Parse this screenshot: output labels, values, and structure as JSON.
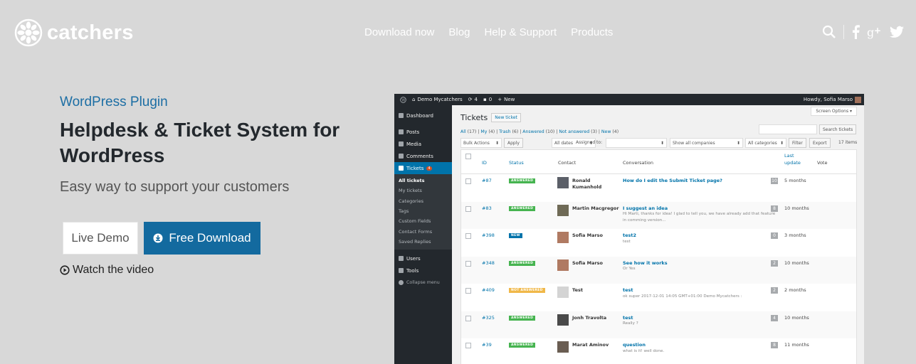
{
  "brand": {
    "name": "catchers"
  },
  "nav": [
    "Download now",
    "Blog",
    "Help & Support",
    "Products"
  ],
  "social_icons": [
    "search-icon",
    "facebook-icon",
    "google-plus-icon",
    "twitter-icon"
  ],
  "hero": {
    "eyebrow": "WordPress Plugin",
    "title": "Helpdesk & Ticket System for WordPress",
    "subtitle": "Easy way to support your customers",
    "live_demo": "Live Demo",
    "free_download": "Free Download",
    "watch_video": "Watch the video"
  },
  "colors": {
    "background": "#d8d8d8",
    "accent": "#1c6ea4",
    "download_button": "#136a9f",
    "wp_dark": "#23282d",
    "wp_blue": "#0073aa"
  },
  "screenshot": {
    "admin_bar": {
      "site": "Demo Mycatchers",
      "updates": "4",
      "comments": "0",
      "new": "New",
      "howdy": "Howdy, Sofia Marso"
    },
    "menu": {
      "dashboard": "Dashboard",
      "posts": "Posts",
      "media": "Media",
      "comments": "Comments",
      "tickets": "Tickets",
      "tickets_badge": "4",
      "submenu": [
        "All tickets",
        "My tickets",
        "Categories",
        "Tags",
        "Custom Fields",
        "Contact Forms",
        "Saved Replies"
      ],
      "users": "Users",
      "tools": "Tools",
      "collapse": "Collapse menu"
    },
    "screen_options": "Screen Options ▾",
    "page_title": "Tickets",
    "new_ticket": "New ticket",
    "views": {
      "all": "All",
      "all_count": "(17)",
      "my": "My",
      "my_count": "(4)",
      "trash": "Trash",
      "trash_count": "(6)",
      "answered": "Answered",
      "answered_count": "(10)",
      "not_answered": "Not answered",
      "not_answered_count": "(3)",
      "new": "New",
      "new_count": "(4)"
    },
    "search_button": "Search tickets",
    "filters": {
      "bulk": "Bulk Actions",
      "apply": "Apply",
      "dates": "All dates",
      "assigned": "Assigned to:",
      "companies": "Show all companies",
      "categories": "All categories",
      "filter": "Filter",
      "export": "Export",
      "items": "17 items"
    },
    "columns": {
      "id": "ID",
      "status": "Status",
      "contact": "Contact",
      "conversation": "Conversation",
      "last_update_1": "Last",
      "last_update_2": "update",
      "vote": "Vote"
    },
    "rows": [
      {
        "id": "#87",
        "status": "ANSWERED",
        "status_color": "#46b450",
        "contact_1": "Ronald",
        "contact_2": "Kumanhold",
        "subject": "How do I edit the Submit Ticket page?",
        "excerpt_1": "",
        "excerpt_2": "",
        "votes": "10",
        "updated": "5 months",
        "avatar": "#5b5f68"
      },
      {
        "id": "#83",
        "status": "ANSWERED",
        "status_color": "#46b450",
        "contact_1": "Martin Macgregor",
        "contact_2": "",
        "subject": "I suggest an idea",
        "excerpt_1": "Hi Marti, thanks for idea! I glad to tell you, we have already add that feature",
        "excerpt_2": "in comming version...",
        "votes": "8",
        "updated": "10 months",
        "avatar": "#6f6a56"
      },
      {
        "id": "#398",
        "status": "NEW",
        "status_color": "#0073aa",
        "contact_1": "Sofia Marso",
        "contact_2": "",
        "subject": "test2",
        "excerpt_1": "test",
        "excerpt_2": "",
        "votes": "0",
        "updated": "3 months",
        "avatar": "#b07a62"
      },
      {
        "id": "#348",
        "status": "ANSWERED",
        "status_color": "#46b450",
        "contact_1": "Sofia Marso",
        "contact_2": "",
        "subject": "See how it works",
        "excerpt_1": "Or Yes",
        "excerpt_2": "",
        "votes": "2",
        "updated": "10 months",
        "avatar": "#b07a62"
      },
      {
        "id": "#409",
        "status": "NOT ANSWERED",
        "status_color": "#f0b849",
        "contact_1": "Test",
        "contact_2": "",
        "subject": "test",
        "excerpt_1": "ok super 2017-12-01 14:05 GMT+01:00 Demo Mycatchers :",
        "excerpt_2": "",
        "votes": "2",
        "updated": "2 months",
        "avatar": "#d4d4d4"
      },
      {
        "id": "#325",
        "status": "ANSWERED",
        "status_color": "#46b450",
        "contact_1": "Jonh Travolta",
        "contact_2": "",
        "subject": "test",
        "excerpt_1": "Really ?",
        "excerpt_2": "",
        "votes": "4",
        "updated": "10 months",
        "avatar": "#4a4a4a"
      },
      {
        "id": "#39",
        "status": "ANSWERED",
        "status_color": "#46b450",
        "contact_1": "Marat Aminov",
        "contact_2": "",
        "subject": "question",
        "excerpt_1": "what is it!  well done.",
        "excerpt_2": "",
        "votes": "8",
        "updated": "11 months",
        "avatar": "#6a5d52"
      }
    ]
  }
}
